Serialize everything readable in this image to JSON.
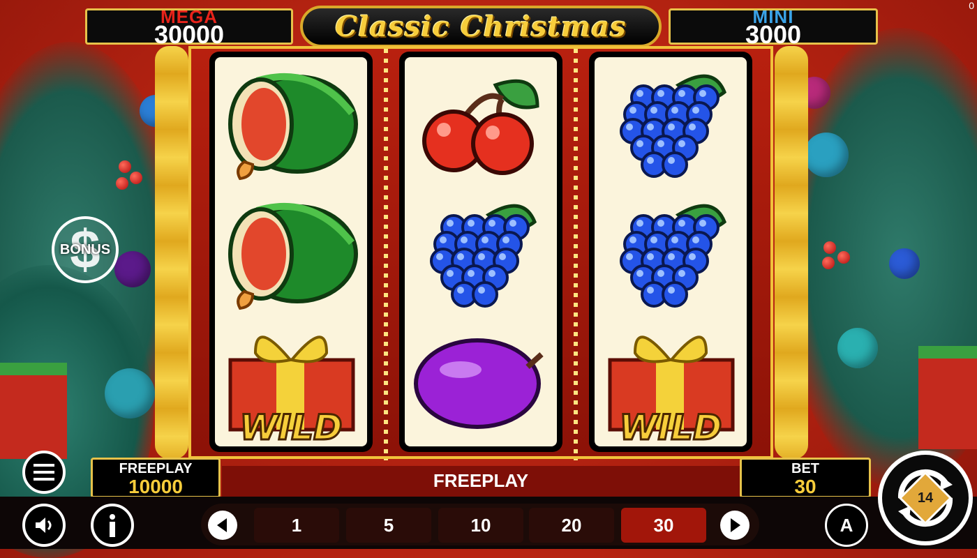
{
  "jackpots": {
    "mega": {
      "label": "MEGA",
      "value": "30000",
      "label_color": "#e8231a"
    },
    "mini": {
      "label": "MINI",
      "value": "3000",
      "label_color": "#3aa3e8"
    }
  },
  "game_title": "Classic Christmas",
  "corner_indicator": "0",
  "bonus_button": {
    "label": "BONUS"
  },
  "reels": [
    {
      "symbols": [
        "watermelon",
        "watermelon",
        "wild-gift"
      ]
    },
    {
      "symbols": [
        "cherries",
        "grapes",
        "plum"
      ]
    },
    {
      "symbols": [
        "grapes",
        "grapes",
        "wild-gift"
      ]
    }
  ],
  "wild_label": "WILD",
  "balance": {
    "label": "FREEPLAY",
    "value": "10000"
  },
  "status_message": "FREEPLAY",
  "bet": {
    "label": "BET",
    "value": "30"
  },
  "bet_options": [
    "1",
    "5",
    "10",
    "20",
    "30"
  ],
  "selected_bet": "30",
  "autoplay_label": "A",
  "spin_badge": "14",
  "colors": {
    "accent_gold": "#f7cd3b",
    "frame_red": "#a2160a",
    "selected_bet_bg": "#a2160a"
  }
}
